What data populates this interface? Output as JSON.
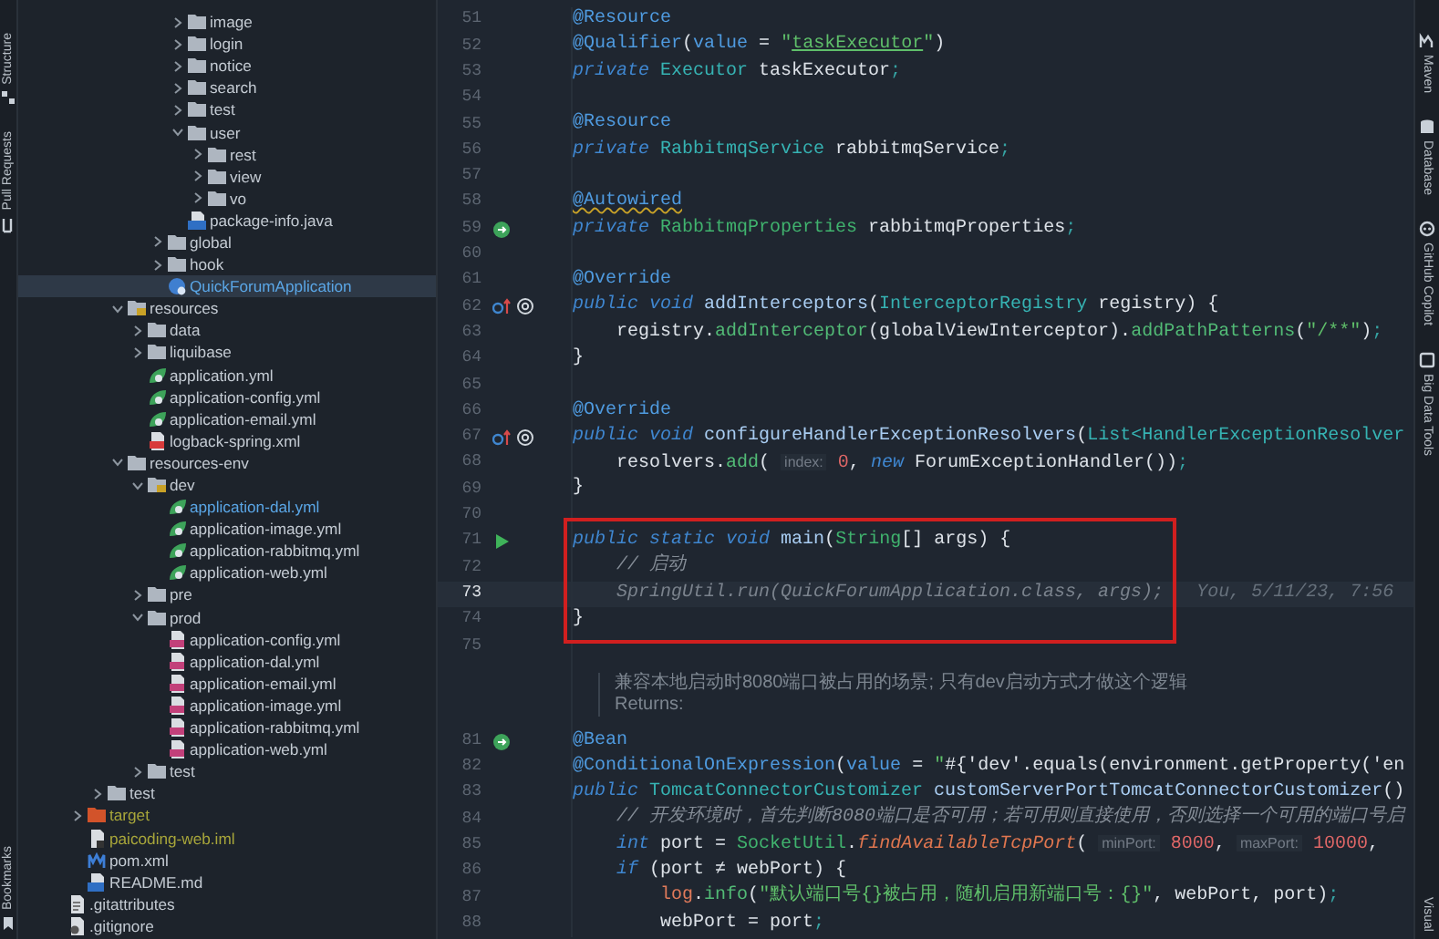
{
  "left_strip": [
    {
      "label": "Structure",
      "kind": "structure"
    },
    {
      "label": "Pull Requests",
      "kind": "pull"
    },
    {
      "label": "Bookmarks",
      "kind": "bookmark"
    }
  ],
  "tree": [
    {
      "children": [
        {
          "children": [
            {
              "children": [
                {
                  "children": [
                    {
                      "children": [
                        {
                          "children": [
                            {
                              "name": "image",
                              "kind": "folder",
                              "expanded": false,
                              "selected": false
                            },
                            {
                              "name": "login",
                              "kind": "folder",
                              "expanded": false,
                              "selected": false
                            },
                            {
                              "name": "notice",
                              "kind": "folder",
                              "expanded": false,
                              "selected": false
                            },
                            {
                              "name": "search",
                              "kind": "folder",
                              "expanded": false,
                              "selected": false
                            },
                            {
                              "name": "test",
                              "kind": "folder",
                              "expanded": false,
                              "selected": false
                            },
                            {
                              "name": "user",
                              "kind": "folder",
                              "expanded": true,
                              "selected": false,
                              "children": [
                                {
                                  "name": "rest",
                                  "kind": "folder",
                                  "expanded": false,
                                  "selected": false
                                },
                                {
                                  "name": "view",
                                  "kind": "folder",
                                  "expanded": false,
                                  "selected": false
                                },
                                {
                                  "name": "vo",
                                  "kind": "folder",
                                  "expanded": false,
                                  "selected": false
                                }
                              ]
                            },
                            {
                              "name": "package-info.java",
                              "kind": "java",
                              "selected": false
                            }
                          ]
                        },
                        {
                          "name": "global",
                          "kind": "folder",
                          "expanded": false,
                          "selected": false
                        },
                        {
                          "name": "hook",
                          "kind": "folder",
                          "expanded": false,
                          "selected": false
                        },
                        {
                          "name": "QuickForumApplication",
                          "kind": "main-class",
                          "modified": true,
                          "selected": true
                        }
                      ]
                    }
                  ]
                },
                {
                  "name": "resources",
                  "kind": "resource-folder",
                  "expanded": true,
                  "selected": false,
                  "children": [
                    {
                      "name": "data",
                      "kind": "folder",
                      "expanded": false,
                      "selected": false
                    },
                    {
                      "name": "liquibase",
                      "kind": "folder",
                      "expanded": false,
                      "selected": false
                    },
                    {
                      "name": "application.yml",
                      "kind": "spring",
                      "selected": false
                    },
                    {
                      "name": "application-config.yml",
                      "kind": "spring",
                      "selected": false
                    },
                    {
                      "name": "application-email.yml",
                      "kind": "spring",
                      "selected": false
                    },
                    {
                      "name": "logback-spring.xml",
                      "kind": "xml",
                      "selected": false
                    }
                  ]
                },
                {
                  "name": "resources-env",
                  "kind": "folder",
                  "expanded": true,
                  "selected": false,
                  "children": [
                    {
                      "name": "dev",
                      "kind": "resource-folder",
                      "expanded": true,
                      "selected": false,
                      "children": [
                        {
                          "name": "application-dal.yml",
                          "kind": "spring",
                          "modified": true,
                          "selected": false
                        },
                        {
                          "name": "application-image.yml",
                          "kind": "spring",
                          "selected": false
                        },
                        {
                          "name": "application-rabbitmq.yml",
                          "kind": "spring",
                          "selected": false
                        },
                        {
                          "name": "application-web.yml",
                          "kind": "spring",
                          "selected": false
                        }
                      ]
                    },
                    {
                      "name": "pre",
                      "kind": "folder",
                      "expanded": false,
                      "selected": false
                    },
                    {
                      "name": "prod",
                      "kind": "folder",
                      "expanded": true,
                      "selected": false,
                      "children": [
                        {
                          "name": "application-config.yml",
                          "kind": "yml",
                          "selected": false
                        },
                        {
                          "name": "application-dal.yml",
                          "kind": "yml",
                          "selected": false
                        },
                        {
                          "name": "application-email.yml",
                          "kind": "yml",
                          "selected": false
                        },
                        {
                          "name": "application-image.yml",
                          "kind": "yml",
                          "selected": false
                        },
                        {
                          "name": "application-rabbitmq.yml",
                          "kind": "yml",
                          "selected": false
                        },
                        {
                          "name": "application-web.yml",
                          "kind": "yml",
                          "selected": false
                        }
                      ]
                    },
                    {
                      "name": "test",
                      "kind": "folder",
                      "expanded": false,
                      "selected": false
                    }
                  ]
                }
              ]
            },
            {
              "name": "test",
              "kind": "folder",
              "expanded": false,
              "selected": false
            }
          ]
        },
        {
          "name": "target",
          "kind": "excluded-folder",
          "ignored": true,
          "expanded": false,
          "selected": false
        },
        {
          "name": "paicoding-web.iml",
          "kind": "iml",
          "ignored": true,
          "selected": false
        },
        {
          "name": "pom.xml",
          "kind": "maven",
          "selected": false
        },
        {
          "name": "README.md",
          "kind": "markdown",
          "selected": false
        }
      ]
    },
    {
      "name": ".gitattributes",
      "kind": "text",
      "selected": false
    },
    {
      "name": ".gitignore",
      "kind": "git",
      "selected": false
    }
  ],
  "editor": {
    "lines": [
      {
        "kind": "code",
        "number": "51",
        "tokens": [
          {
            "kind": "ann",
            "text": "@Resource"
          }
        ]
      },
      {
        "kind": "code",
        "number": "52",
        "tokens": [
          {
            "kind": "ann",
            "text": "@Qualifier"
          },
          {
            "kind": "plain",
            "text": "("
          },
          {
            "kind": "ann",
            "text": "value"
          },
          {
            "kind": "plain",
            "text": " = "
          },
          {
            "kind": "str",
            "text": "\""
          },
          {
            "kind": "strl",
            "text": "taskExecutor"
          },
          {
            "kind": "str",
            "text": "\""
          },
          {
            "kind": "plain",
            "text": ")"
          }
        ]
      },
      {
        "kind": "code",
        "number": "53",
        "tokens": [
          {
            "kind": "kw",
            "text": "private "
          },
          {
            "kind": "type",
            "text": "Executor"
          },
          {
            "kind": "plain",
            "text": " taskExecutor"
          },
          {
            "kind": "punc",
            "text": ";"
          }
        ]
      },
      {
        "kind": "code",
        "number": "54"
      },
      {
        "kind": "code",
        "number": "55",
        "tokens": [
          {
            "kind": "ann",
            "text": "@Resource"
          }
        ]
      },
      {
        "kind": "code",
        "number": "56",
        "tokens": [
          {
            "kind": "kw",
            "text": "private "
          },
          {
            "kind": "type",
            "text": "RabbitmqService"
          },
          {
            "kind": "plain",
            "text": " rabbitmqService"
          },
          {
            "kind": "punc",
            "text": ";"
          }
        ]
      },
      {
        "kind": "code",
        "number": "57"
      },
      {
        "kind": "code",
        "number": "58",
        "tokens": [
          {
            "kind": "annw",
            "text": "@Autowired"
          }
        ]
      },
      {
        "kind": "code",
        "number": "59",
        "gutter": [
          {
            "kind": "bean"
          }
        ],
        "tokens": [
          {
            "kind": "kw",
            "text": "private "
          },
          {
            "kind": "type2",
            "text": "RabbitmqProperties"
          },
          {
            "kind": "plain",
            "text": " rabbitmqProperties"
          },
          {
            "kind": "punc",
            "text": ";"
          }
        ]
      },
      {
        "kind": "code",
        "number": "60"
      },
      {
        "kind": "code",
        "number": "61",
        "tokens": [
          {
            "kind": "ann",
            "text": "@Override"
          }
        ]
      },
      {
        "kind": "code",
        "number": "62",
        "gutter": [
          {
            "kind": "override"
          },
          {
            "kind": "at"
          }
        ],
        "tokens": [
          {
            "kind": "kw",
            "text": "public void "
          },
          {
            "kind": "decl",
            "text": "addInterceptors"
          },
          {
            "kind": "plain",
            "text": "("
          },
          {
            "kind": "type",
            "text": "InterceptorRegistry"
          },
          {
            "kind": "plain",
            "text": " registry) {"
          }
        ]
      },
      {
        "kind": "code",
        "number": "63",
        "tokens": [
          {
            "kind": "plain",
            "text": "    registry."
          },
          {
            "kind": "call",
            "text": "addInterceptor"
          },
          {
            "kind": "plain",
            "text": "(globalViewInterceptor)."
          },
          {
            "kind": "call",
            "text": "addPathPatterns"
          },
          {
            "kind": "plain",
            "text": "("
          },
          {
            "kind": "str",
            "text": "\"/**\""
          },
          {
            "kind": "plain",
            "text": ")"
          },
          {
            "kind": "punc",
            "text": ";"
          }
        ]
      },
      {
        "kind": "code",
        "number": "64",
        "tokens": [
          {
            "kind": "plain",
            "text": "}"
          }
        ]
      },
      {
        "kind": "code",
        "number": "65"
      },
      {
        "kind": "code",
        "number": "66",
        "tokens": [
          {
            "kind": "ann",
            "text": "@Override"
          }
        ]
      },
      {
        "kind": "code",
        "number": "67",
        "gutter": [
          {
            "kind": "override"
          },
          {
            "kind": "at"
          }
        ],
        "tokens": [
          {
            "kind": "kw",
            "text": "public void "
          },
          {
            "kind": "decl",
            "text": "configureHandlerExceptionResolvers"
          },
          {
            "kind": "plain",
            "text": "("
          },
          {
            "kind": "type",
            "text": "List<HandlerExceptionResolver"
          }
        ]
      },
      {
        "kind": "code",
        "number": "68",
        "tokens": [
          {
            "kind": "plain",
            "text": "    resolvers."
          },
          {
            "kind": "call",
            "text": "add"
          },
          {
            "kind": "plain",
            "text": "( "
          },
          {
            "kind": "hint",
            "text": "index:"
          },
          {
            "kind": "num",
            "text": " 0"
          },
          {
            "kind": "plain",
            "text": ", "
          },
          {
            "kind": "kw",
            "text": "new "
          },
          {
            "kind": "plain",
            "text": "ForumExceptionHandler())"
          },
          {
            "kind": "punc",
            "text": ";"
          }
        ]
      },
      {
        "kind": "code",
        "number": "69",
        "tokens": [
          {
            "kind": "plain",
            "text": "}"
          }
        ]
      },
      {
        "kind": "code",
        "number": "70"
      },
      {
        "kind": "code",
        "number": "71",
        "boxed": true,
        "gutter": [
          {
            "kind": "run"
          }
        ],
        "tokens": [
          {
            "kind": "kw",
            "text": "public static void "
          },
          {
            "kind": "decl",
            "text": "main"
          },
          {
            "kind": "plain",
            "text": "("
          },
          {
            "kind": "type2",
            "text": "String"
          },
          {
            "kind": "plain",
            "text": "[] args) {"
          }
        ]
      },
      {
        "kind": "code",
        "number": "72",
        "boxed": true,
        "tokens": [
          {
            "kind": "cm",
            "text": "    // 启动"
          }
        ]
      },
      {
        "kind": "code",
        "number": "73",
        "current": true,
        "boxed": true,
        "blame": "You, 5/11/23, 7:56",
        "tokens": [
          {
            "kind": "dim",
            "text": "    SpringUtil.run(QuickForumApplication.class, args);"
          }
        ]
      },
      {
        "kind": "code",
        "number": "74",
        "boxed": true,
        "tokens": [
          {
            "kind": "plain",
            "text": "}"
          }
        ]
      },
      {
        "kind": "code",
        "number": "75"
      },
      {
        "kind": "doc",
        "text": [
          "兼容本地启动时8080端口被占用的场景; 只有dev启动方式才做这个逻辑",
          "Returns:"
        ]
      },
      {
        "kind": "code",
        "number": "81",
        "gutter": [
          {
            "kind": "bean"
          }
        ],
        "tokens": [
          {
            "kind": "ann",
            "text": "@Bean"
          }
        ]
      },
      {
        "kind": "code",
        "number": "82",
        "tokens": [
          {
            "kind": "ann",
            "text": "@ConditionalOnExpression"
          },
          {
            "kind": "plain",
            "text": "("
          },
          {
            "kind": "ann",
            "text": "value"
          },
          {
            "kind": "plain",
            "text": " = "
          },
          {
            "kind": "str",
            "text": "\""
          },
          {
            "kind": "plain",
            "text": "#{'dev'.equals(environment.getProperty('en"
          }
        ]
      },
      {
        "kind": "code",
        "number": "83",
        "tokens": [
          {
            "kind": "kw",
            "text": "public "
          },
          {
            "kind": "type",
            "text": "TomcatConnectorCustomizer"
          },
          {
            "kind": "decl",
            "text": " customServerPortTomcatConnectorCustomizer"
          },
          {
            "kind": "plain",
            "text": "()"
          }
        ]
      },
      {
        "kind": "code",
        "number": "84",
        "tokens": [
          {
            "kind": "cm",
            "text": "    // 开发环境时，首先判断8080端口是否可用；若可用则直接使用，否则选择一个可用的端口号启"
          }
        ]
      },
      {
        "kind": "code",
        "number": "85",
        "tokens": [
          {
            "kind": "kw",
            "text": "    int "
          },
          {
            "kind": "plain",
            "text": "port = "
          },
          {
            "kind": "type2",
            "text": "SocketUtil"
          },
          {
            "kind": "plain",
            "text": "."
          },
          {
            "kind": "smeth",
            "text": "findAvailableTcpPort"
          },
          {
            "kind": "plain",
            "text": "( "
          },
          {
            "kind": "hint",
            "text": "minPort:"
          },
          {
            "kind": "num",
            "text": " 8000"
          },
          {
            "kind": "plain",
            "text": ", "
          },
          {
            "kind": "hint",
            "text": "maxPort:"
          },
          {
            "kind": "num",
            "text": " 10000"
          },
          {
            "kind": "plain",
            "text": ","
          }
        ]
      },
      {
        "kind": "code",
        "number": "86",
        "tokens": [
          {
            "kind": "kw",
            "text": "    if "
          },
          {
            "kind": "plain",
            "text": "(port ≠ webPort) {"
          }
        ]
      },
      {
        "kind": "code",
        "number": "87",
        "tokens": [
          {
            "kind": "field",
            "text": "        log"
          },
          {
            "kind": "plain",
            "text": "."
          },
          {
            "kind": "call",
            "text": "info"
          },
          {
            "kind": "plain",
            "text": "("
          },
          {
            "kind": "str",
            "text": "\"默认端口号{}被占用，随机启用新端口号：{}\""
          },
          {
            "kind": "plain",
            "text": ", webPort, port)"
          },
          {
            "kind": "punc",
            "text": ";"
          }
        ]
      },
      {
        "kind": "code",
        "number": "88",
        "tokens": [
          {
            "kind": "plain",
            "text": "        webPort = port"
          },
          {
            "kind": "punc",
            "text": ";"
          }
        ]
      }
    ]
  },
  "right_strip": [
    {
      "label": "Maven",
      "kind": "maven"
    },
    {
      "label": "Database",
      "kind": "database"
    },
    {
      "label": "GitHub Copilot",
      "kind": "copilot"
    },
    {
      "label": "Big Data Tools",
      "kind": "bigdata"
    },
    {
      "label": "Visual",
      "kind": "plain"
    }
  ]
}
